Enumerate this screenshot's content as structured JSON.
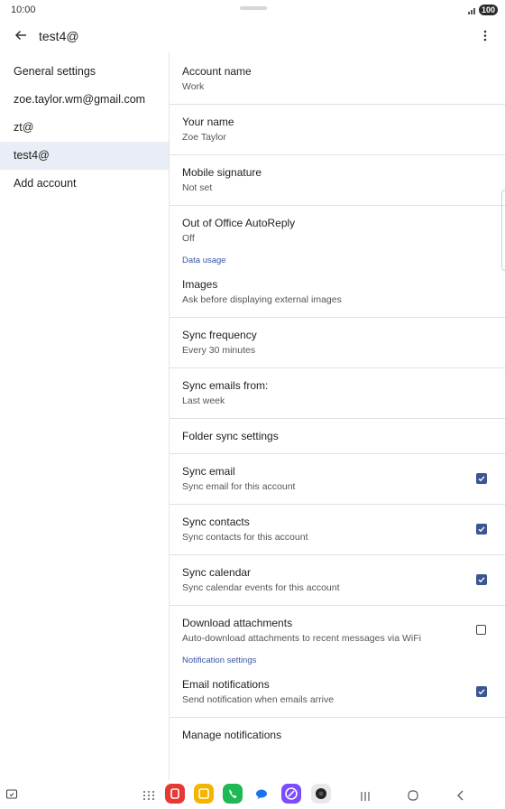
{
  "status": {
    "time": "10:00",
    "battery": "100"
  },
  "appbar": {
    "title": "test4@"
  },
  "sidebar": {
    "items": [
      {
        "label": "General settings"
      },
      {
        "label": "zoe.taylor.wm@gmail.com"
      },
      {
        "label": "zt@"
      },
      {
        "label": "test4@"
      },
      {
        "label": "Add account"
      }
    ]
  },
  "settings": {
    "account_name": {
      "title": "Account name",
      "value": "Work"
    },
    "your_name": {
      "title": "Your name",
      "value": "Zoe Taylor"
    },
    "mobile_signature": {
      "title": "Mobile signature",
      "value": "Not set"
    },
    "out_of_office": {
      "title": "Out of Office AutoReply",
      "value": "Off"
    },
    "data_usage_header": "Data usage",
    "images": {
      "title": "Images",
      "value": "Ask before displaying external images"
    },
    "sync_frequency": {
      "title": "Sync frequency",
      "value": "Every 30 minutes"
    },
    "sync_emails_from": {
      "title": "Sync emails from:",
      "value": "Last week"
    },
    "folder_sync": {
      "title": "Folder sync settings"
    },
    "sync_email": {
      "title": "Sync email",
      "value": "Sync email for this account",
      "checked": true
    },
    "sync_contacts": {
      "title": "Sync contacts",
      "value": "Sync contacts for this account",
      "checked": true
    },
    "sync_calendar": {
      "title": "Sync calendar",
      "value": "Sync calendar events for this account",
      "checked": true
    },
    "download_attachments": {
      "title": "Download attachments",
      "value": "Auto-download attachments to recent messages via WiFi",
      "checked": false
    },
    "notification_header": "Notification settings",
    "email_notifications": {
      "title": "Email notifications",
      "value": "Send notification when emails arrive",
      "checked": true
    },
    "manage_notifications": {
      "title": "Manage notifications"
    }
  },
  "colors": {
    "accent": "#3c5693",
    "selected_bg": "#e9eef6",
    "section_text": "#3a56a5"
  },
  "navbar": {
    "icons": [
      "screenshot-icon",
      "app-drawer-icon",
      "app-red-icon",
      "app-yellow-icon",
      "app-green-phone-icon",
      "app-blue-messages-icon",
      "app-purple-icon",
      "app-camera-icon",
      "recents-icon",
      "home-icon",
      "back-nav-icon"
    ]
  }
}
